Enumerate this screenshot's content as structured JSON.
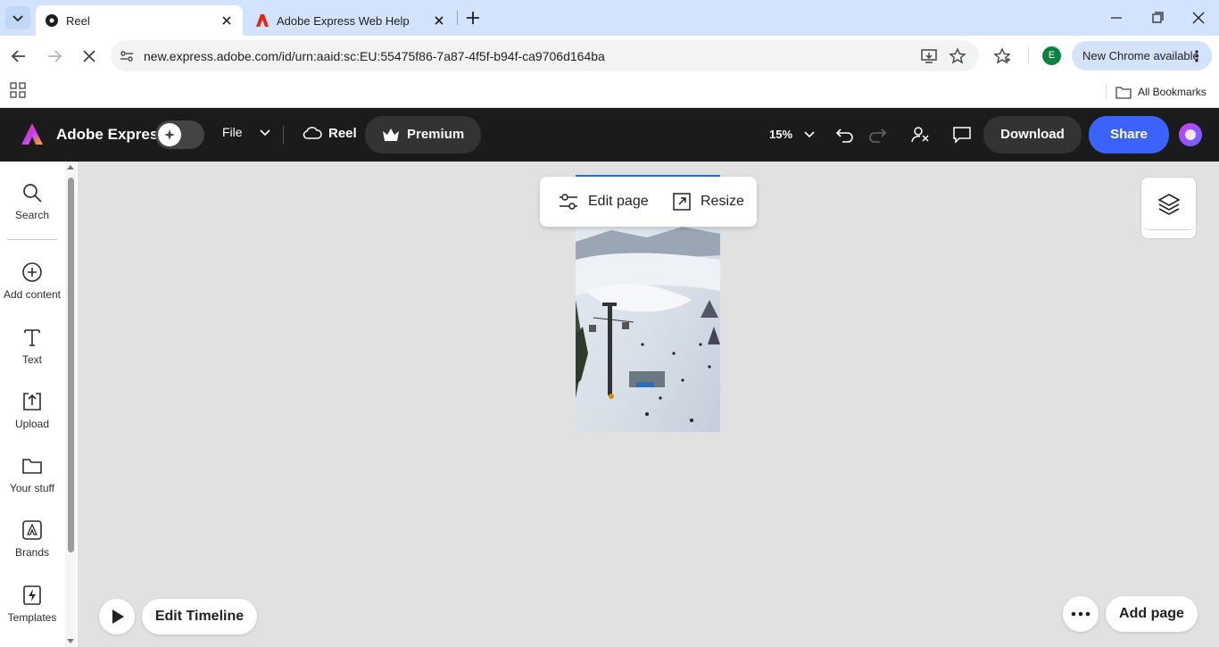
{
  "browser": {
    "tabs": [
      {
        "title": "Reel",
        "active": true
      },
      {
        "title": "Adobe Express Web Help",
        "active": false
      }
    ],
    "url": "new.express.adobe.com/id/urn:aaid:sc:EU:55475f86-7a87-4f5f-b94f-ca9706d164ba",
    "profile_initial": "E",
    "update_label": "New Chrome available",
    "bookmarks_label": "All Bookmarks"
  },
  "header": {
    "brand": "Adobe Express",
    "file_label": "File",
    "doc_name": "Reel",
    "premium_label": "Premium",
    "zoom": "15%",
    "download_label": "Download",
    "share_label": "Share",
    "colors": {
      "bar": "#1b1b1b",
      "share": "#3b63fb",
      "pill": "#333333"
    }
  },
  "rail": {
    "items": [
      {
        "label": "Search",
        "icon": "search-icon"
      },
      {
        "label": "Add content",
        "icon": "plus-circle-icon"
      },
      {
        "label": "Text",
        "icon": "text-icon"
      },
      {
        "label": "Upload",
        "icon": "upload-icon"
      },
      {
        "label": "Your stuff",
        "icon": "folder-icon"
      },
      {
        "label": "Brands",
        "icon": "brand-icon"
      },
      {
        "label": "Templates",
        "icon": "templates-icon"
      }
    ]
  },
  "canvas": {
    "edit_page_label": "Edit page",
    "resize_label": "Resize",
    "edit_timeline_label": "Edit Timeline",
    "add_page_label": "Add page"
  }
}
